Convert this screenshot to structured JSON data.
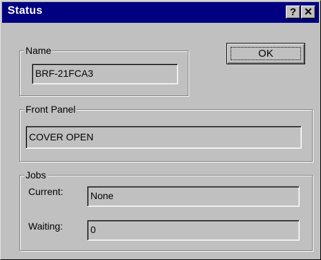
{
  "window": {
    "title": "Status",
    "help_label": "?",
    "close_label": "✕"
  },
  "name_group": {
    "label": "Name",
    "value": "BRF-21FCA3"
  },
  "ok_button": {
    "label": "OK"
  },
  "front_panel_group": {
    "label": "Front Panel",
    "value": "COVER OPEN"
  },
  "jobs_group": {
    "label": "Jobs",
    "current_label": "Current:",
    "current_value": "None",
    "waiting_label": "Waiting:",
    "waiting_value": "0"
  }
}
